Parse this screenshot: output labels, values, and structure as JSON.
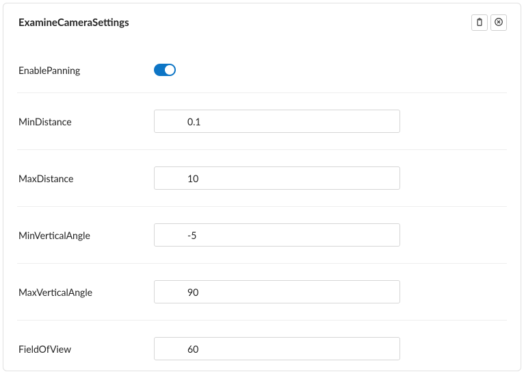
{
  "panel": {
    "title": "ExamineCameraSettings"
  },
  "fields": {
    "enablePanning": {
      "label": "EnablePanning",
      "value": true
    },
    "minDistance": {
      "label": "MinDistance",
      "value": "0.1"
    },
    "maxDistance": {
      "label": "MaxDistance",
      "value": "10"
    },
    "minVerticalAngle": {
      "label": "MinVerticalAngle",
      "value": "-5"
    },
    "maxVerticalAngle": {
      "label": "MaxVerticalAngle",
      "value": "90"
    },
    "fieldOfView": {
      "label": "FieldOfView",
      "value": "60"
    }
  }
}
